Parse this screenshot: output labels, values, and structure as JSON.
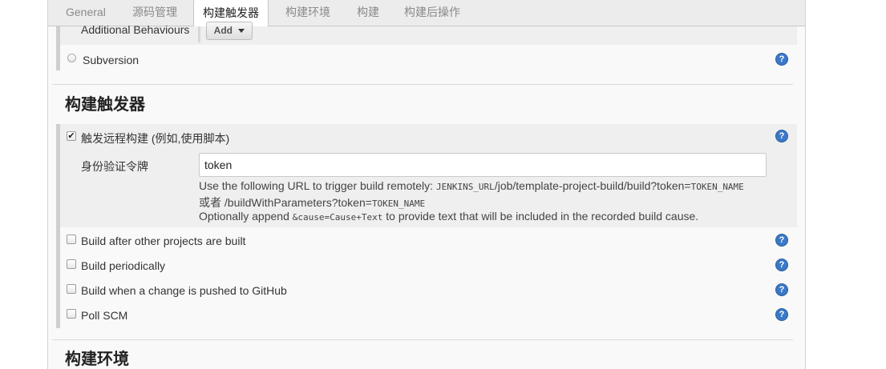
{
  "tabs": [
    {
      "label": "General"
    },
    {
      "label": "源码管理"
    },
    {
      "label": "构建触发器"
    },
    {
      "label": "构建环境"
    },
    {
      "label": "构建"
    },
    {
      "label": "构建后操作"
    }
  ],
  "scm": {
    "additional_behaviours_label": "Additional Behaviours",
    "add_button_label": "Add",
    "subversion_label": "Subversion"
  },
  "triggers": {
    "section_title": "构建触发器",
    "remote_trigger": {
      "label": "触发远程构建 (例如,使用脚本)",
      "checked": true,
      "token_label": "身份验证令牌",
      "token_value": "token",
      "desc_line1_prefix": "Use the following URL to trigger build remotely: ",
      "desc_line1_code_a": "JENKINS_URL",
      "desc_line1_mid": "/job/template-project-build/build?token=",
      "desc_line1_code_b": "TOKEN_NAME",
      "desc_line2_prefix": "或者 /buildWithParameters?token=",
      "desc_line2_code": "TOKEN_NAME",
      "desc_line3_prefix": "Optionally append ",
      "desc_line3_code": "&cause=Cause+Text",
      "desc_line3_suffix": " to provide text that will be included in the recorded build cause."
    },
    "options": [
      {
        "label": "Build after other projects are built",
        "checked": false
      },
      {
        "label": "Build periodically",
        "checked": false
      },
      {
        "label": "Build when a change is pushed to GitHub",
        "checked": false
      },
      {
        "label": "Poll SCM",
        "checked": false
      }
    ]
  },
  "build_env": {
    "section_title": "构建环境"
  },
  "help_icon_glyph": "?",
  "checkmark_glyph": "✔",
  "colors": {
    "help_icon": "#3b79c7",
    "panel_bg": "#f9f9f9",
    "tab_bar_bg": "#ececec"
  }
}
